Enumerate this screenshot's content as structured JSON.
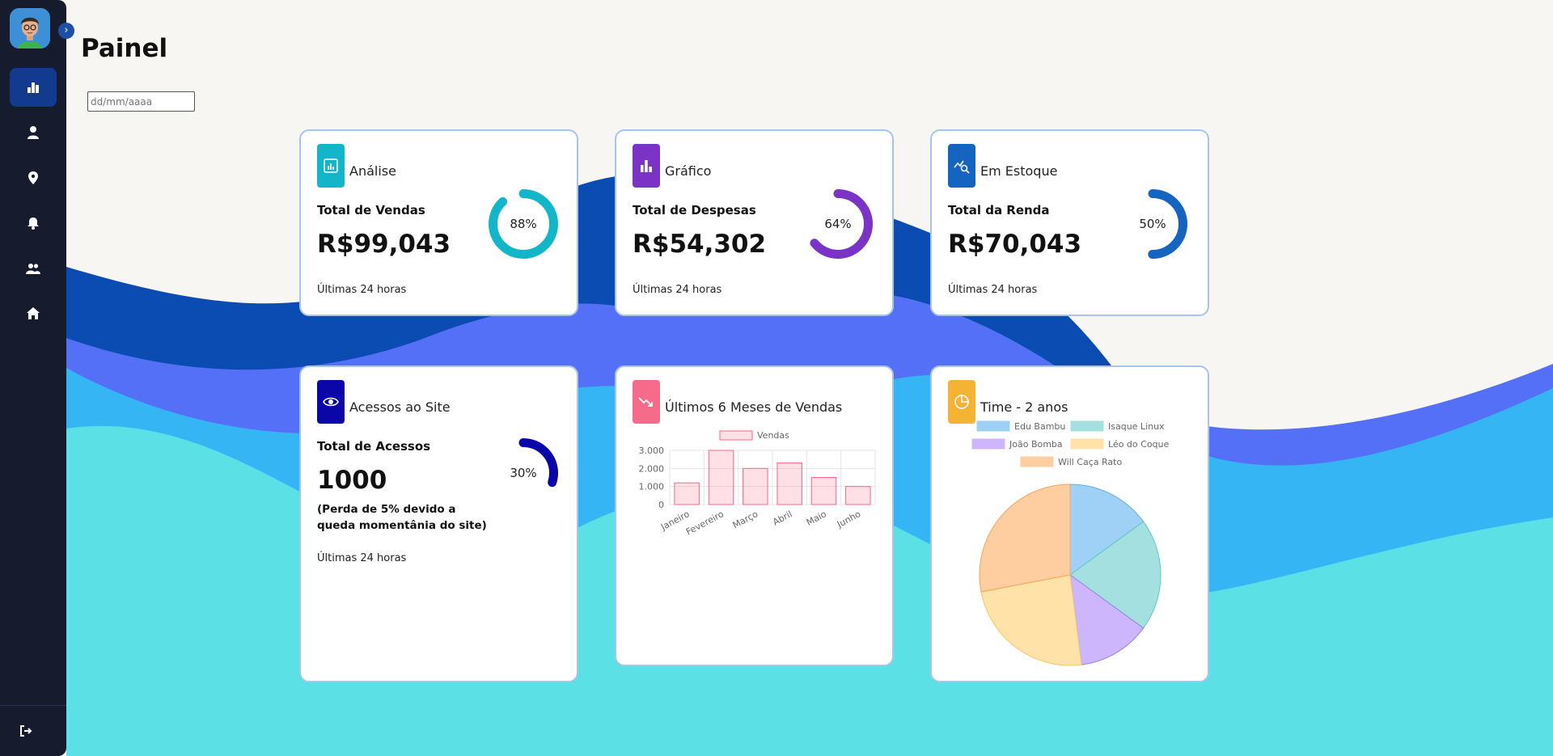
{
  "colors": {
    "sidebar_bg": "#161b2e",
    "sidebar_active": "#123a8f",
    "wave_dark": "#0a4cb2",
    "wave_mid": "#5470f7",
    "wave_light": "#35b5f4",
    "wave_cyan": "#5be0e6",
    "accent_analise": "#13b6c9",
    "accent_grafico": "#7b33c6",
    "accent_estoque": "#1565c0",
    "accent_acessos": "#0a06a8",
    "accent_meses": "#f76b8a",
    "accent_time": "#f5b335"
  },
  "sidebar": {
    "items": [
      {
        "name": "dashboard",
        "icon": "bar-chart-icon",
        "active": true
      },
      {
        "name": "user",
        "icon": "user-icon"
      },
      {
        "name": "location",
        "icon": "map-pin-icon"
      },
      {
        "name": "notifications",
        "icon": "bell-icon"
      },
      {
        "name": "team",
        "icon": "users-icon"
      },
      {
        "name": "home",
        "icon": "home-icon"
      }
    ],
    "logout_icon": "logout-icon"
  },
  "page": {
    "title": "Painel",
    "date_placeholder": "dd/mm/aaaa"
  },
  "cards": {
    "analise": {
      "label": "Análise",
      "subtitle": "Total de Vendas",
      "value": "R$99,043",
      "percent": 88,
      "percent_text": "88%",
      "footer": "Últimas 24 horas"
    },
    "grafico": {
      "label": "Gráfico",
      "subtitle": "Total de Despesas",
      "value": "R$54,302",
      "percent": 64,
      "percent_text": "64%",
      "footer": "Últimas 24 horas"
    },
    "estoque": {
      "label": "Em Estoque",
      "subtitle": "Total da Renda",
      "value": "R$70,043",
      "percent": 50,
      "percent_text": "50%",
      "footer": "Últimas 24 horas"
    },
    "acessos": {
      "label": "Acessos ao Site",
      "subtitle": "Total de Acessos",
      "value": "1000",
      "note": "(Perda de 5% devido a queda momentânia do site)",
      "percent": 30,
      "percent_text": "30%",
      "footer": "Últimas 24 horas"
    },
    "meses": {
      "label": "Últimos 6 Meses de Vendas"
    },
    "time": {
      "label": "Time - 2 anos"
    }
  },
  "chart_data": [
    {
      "type": "bar",
      "categories": [
        "Janeiro",
        "Fevereiro",
        "Março",
        "Abril",
        "Maio",
        "Junho"
      ],
      "series": [
        {
          "name": "Vendas",
          "values": [
            1200,
            3000,
            2000,
            2300,
            1500,
            1000
          ]
        }
      ],
      "ylim": [
        0,
        3000
      ],
      "yticks": [
        "0",
        "1.000",
        "2.000",
        "3.000"
      ],
      "grid": true,
      "legend": "top"
    },
    {
      "type": "pie",
      "labels": [
        "Edu Bambu",
        "Isaque Linux",
        "João Bomba",
        "Léo do Coque",
        "Will Caça Rato"
      ],
      "values": [
        15,
        20,
        13,
        24,
        28
      ],
      "colors": [
        "#9fd0f5",
        "#a5e0e0",
        "#cdb6fb",
        "#ffe2a8",
        "#ffcea0"
      ],
      "legend": "top"
    }
  ]
}
